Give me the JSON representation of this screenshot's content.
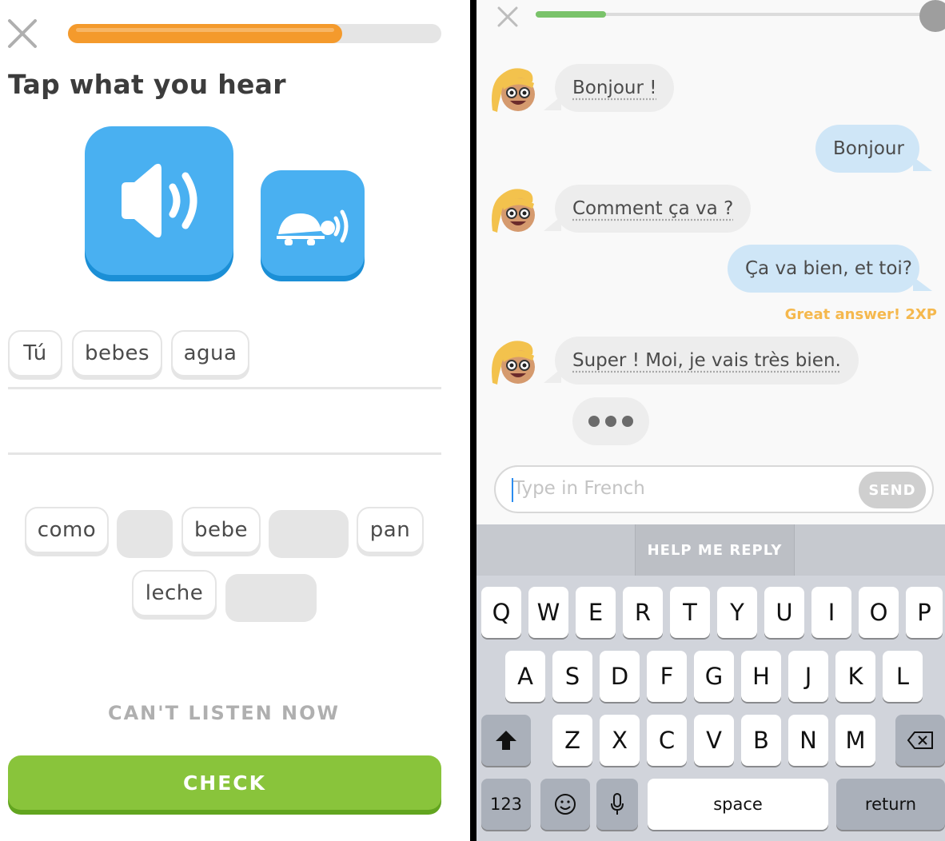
{
  "left": {
    "progress_fraction": 0.735,
    "title": "Tap what you hear",
    "selected_words": [
      "Tú",
      "bebes",
      "agua"
    ],
    "word_bank_row1": [
      "como",
      "",
      "bebe",
      "",
      "pan"
    ],
    "word_bank_row2": [
      "leche",
      ""
    ],
    "cant_listen_label": "CAN'T LISTEN NOW",
    "check_label": "CHECK",
    "colors": {
      "accent_blue": "#49b0f1",
      "progress": "#f49a2c",
      "check": "#89c43b"
    }
  },
  "right": {
    "progress_fraction": 0.18,
    "messages": [
      {
        "from": "bot",
        "text": "Bonjour !"
      },
      {
        "from": "user",
        "text": "Bonjour"
      },
      {
        "from": "bot",
        "text": "Comment ça va ?"
      },
      {
        "from": "user",
        "text": "Ça va bien, et toi?"
      },
      {
        "from": "bot",
        "text": "Super ! Moi, je vais très bien."
      }
    ],
    "xp_note": "Great answer! 2XP",
    "input_placeholder": "Type in French",
    "send_label": "SEND",
    "help_label": "HELP ME REPLY",
    "keyboard": {
      "row1": [
        "Q",
        "W",
        "E",
        "R",
        "T",
        "Y",
        "U",
        "I",
        "O",
        "P"
      ],
      "row2": [
        "A",
        "S",
        "D",
        "F",
        "G",
        "H",
        "J",
        "K",
        "L"
      ],
      "row3": [
        "Z",
        "X",
        "C",
        "V",
        "B",
        "N",
        "M"
      ],
      "numbers_label": "123",
      "space_label": "space",
      "return_label": "return"
    }
  }
}
